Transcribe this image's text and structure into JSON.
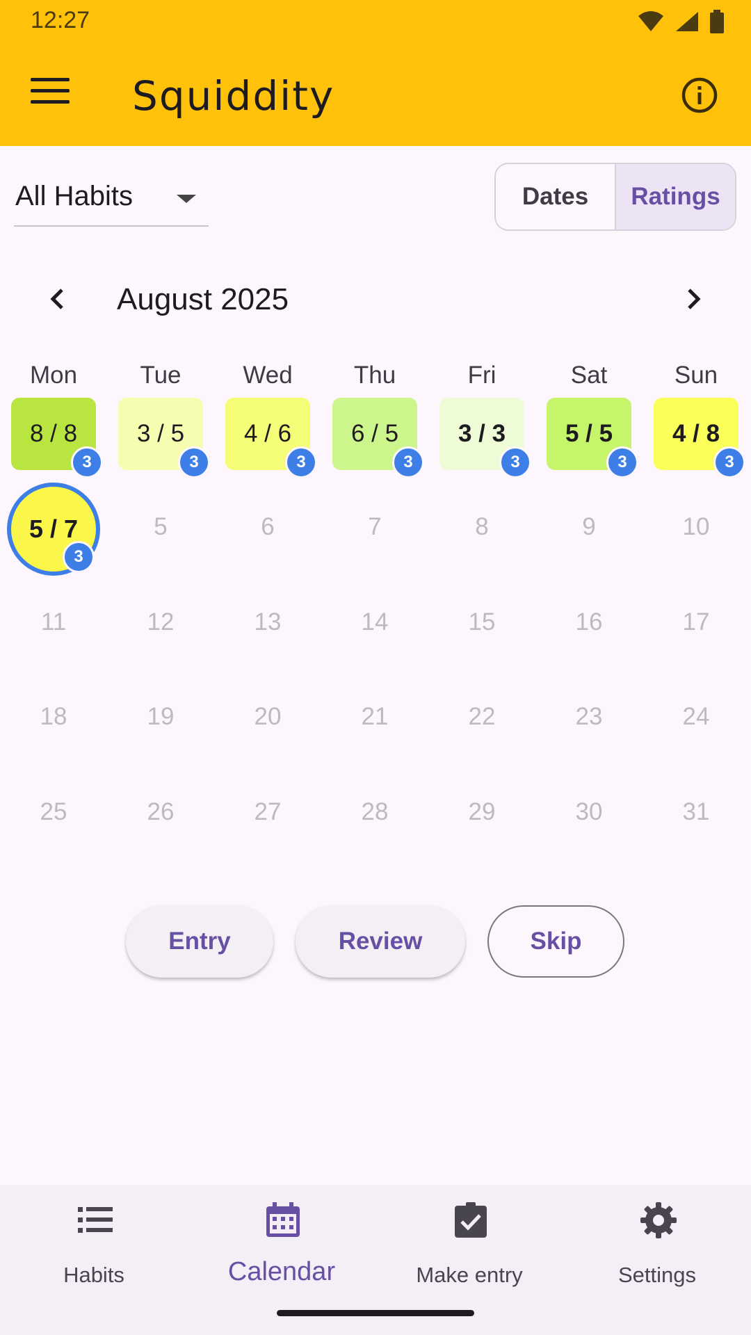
{
  "status_bar": {
    "time": "12:27"
  },
  "app_bar": {
    "title": "Squiddity"
  },
  "filter": {
    "selected": "All Habits"
  },
  "view_toggle": {
    "dates": "Dates",
    "ratings": "Ratings",
    "selected": "Ratings"
  },
  "calendar": {
    "month": "August 2025",
    "weekdays": [
      "Mon",
      "Tue",
      "Wed",
      "Thu",
      "Fri",
      "Sat",
      "Sun"
    ],
    "rated_days": [
      {
        "rating": "8 / 8",
        "count": "3",
        "color": "#b9e540"
      },
      {
        "rating": "3 / 5",
        "count": "3",
        "color": "#f7fdb0"
      },
      {
        "rating": "4 / 6",
        "count": "3",
        "color": "#f5fc78"
      },
      {
        "rating": "6 / 5",
        "count": "3",
        "color": "#ccf58c"
      },
      {
        "rating": "3 / 3",
        "count": "3",
        "color": "#edfcd6"
      },
      {
        "rating": "5 / 5",
        "count": "3",
        "color": "#c6f56c"
      },
      {
        "rating": "4 / 8",
        "count": "3",
        "color": "#faff5a"
      }
    ],
    "today": {
      "rating": "5 / 7",
      "count": "3",
      "color": "#faf64a"
    },
    "days": [
      "5",
      "6",
      "7",
      "8",
      "9",
      "10",
      "11",
      "12",
      "13",
      "14",
      "15",
      "16",
      "17",
      "18",
      "19",
      "20",
      "21",
      "22",
      "23",
      "24",
      "25",
      "26",
      "27",
      "28",
      "29",
      "30",
      "31"
    ]
  },
  "actions": {
    "entry": "Entry",
    "review": "Review",
    "skip": "Skip"
  },
  "bottom_nav": {
    "habits": "Habits",
    "calendar": "Calendar",
    "make_entry": "Make entry",
    "settings": "Settings",
    "selected": "Calendar"
  }
}
